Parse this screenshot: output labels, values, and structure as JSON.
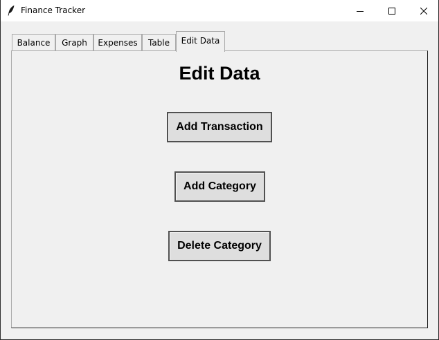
{
  "window": {
    "title": "Finance Tracker"
  },
  "icons": {
    "app": "feather-icon",
    "minimize": "minimize-icon",
    "maximize": "maximize-icon",
    "close": "close-icon"
  },
  "tabs": [
    {
      "label": "Balance",
      "active": false
    },
    {
      "label": "Graph",
      "active": false
    },
    {
      "label": "Expenses",
      "active": false
    },
    {
      "label": "Table",
      "active": false
    },
    {
      "label": "Edit Data",
      "active": true
    }
  ],
  "edit_data": {
    "heading": "Edit Data",
    "buttons": {
      "add_transaction": "Add Transaction",
      "add_category": "Add Category",
      "delete_category": "Delete Category"
    }
  }
}
